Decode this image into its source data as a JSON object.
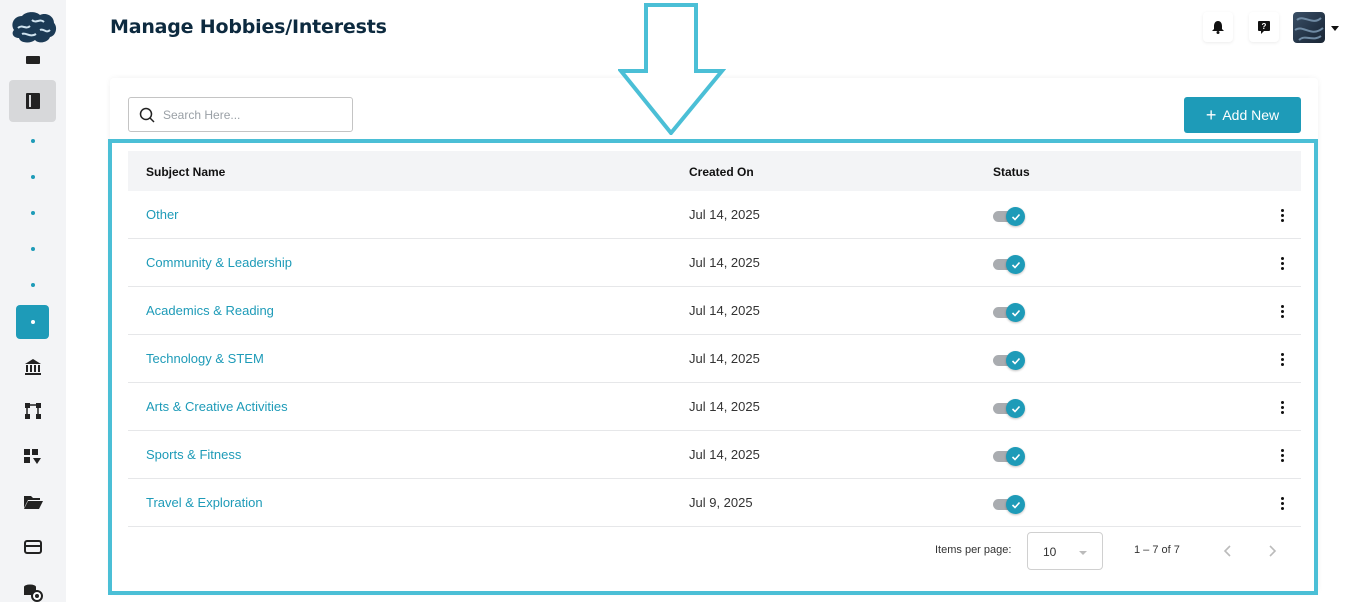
{
  "header": {
    "title": "Manage Hobbies/Interests",
    "notifications_icon": "bell-icon",
    "help_icon": "help-icon"
  },
  "sidebar": {
    "items": [
      {
        "icon": "book-icon"
      },
      {
        "icon": "dot"
      },
      {
        "icon": "dot"
      },
      {
        "icon": "dot"
      },
      {
        "icon": "dot"
      },
      {
        "icon": "dot"
      },
      {
        "icon": "dot"
      },
      {
        "icon": "bank-icon"
      },
      {
        "icon": "flow-icon"
      },
      {
        "icon": "grid-sort-icon"
      },
      {
        "icon": "folder-open-icon"
      },
      {
        "icon": "card-icon"
      },
      {
        "icon": "coins-icon"
      }
    ]
  },
  "toolbar": {
    "search_placeholder": "Search Here...",
    "add_label": "Add New"
  },
  "table": {
    "headers": {
      "name": "Subject Name",
      "created": "Created On",
      "status": "Status"
    },
    "rows": [
      {
        "name": "Other",
        "created": "Jul 14, 2025",
        "active": true
      },
      {
        "name": "Community & Leadership",
        "created": "Jul 14, 2025",
        "active": true
      },
      {
        "name": "Academics & Reading",
        "created": "Jul 14, 2025",
        "active": true
      },
      {
        "name": "Technology & STEM",
        "created": "Jul 14, 2025",
        "active": true
      },
      {
        "name": "Arts & Creative Activities",
        "created": "Jul 14, 2025",
        "active": true
      },
      {
        "name": "Sports & Fitness",
        "created": "Jul 14, 2025",
        "active": true
      },
      {
        "name": "Travel & Exploration",
        "created": "Jul 9, 2025",
        "active": true
      }
    ]
  },
  "pagination": {
    "items_per_page_label": "Items per page:",
    "items_per_page": "10",
    "range": "1 – 7 of 7"
  },
  "colors": {
    "accent": "#1e9bb8",
    "highlight": "#4bbfd6",
    "title": "#0d2a3f"
  }
}
